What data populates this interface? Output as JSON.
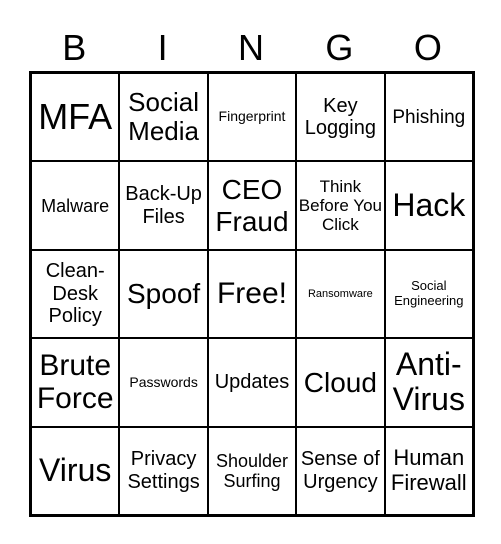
{
  "header": [
    "B",
    "I",
    "N",
    "G",
    "O"
  ],
  "cells": [
    "MFA",
    "Social Media",
    "Fingerprint",
    "Key Logging",
    "Phishing",
    "Malware",
    "Back-Up Files",
    "CEO Fraud",
    "Think Before You Click",
    "Hack",
    "Clean-Desk Policy",
    "Spoof",
    "Free!",
    "Ransomware",
    "Social Engineering",
    "Brute Force",
    "Passwords",
    "Updates",
    "Cloud",
    "Anti-Virus",
    "Virus",
    "Privacy Settings",
    "Shoulder Surfing",
    "Sense of Urgency",
    "Human Firewall"
  ]
}
